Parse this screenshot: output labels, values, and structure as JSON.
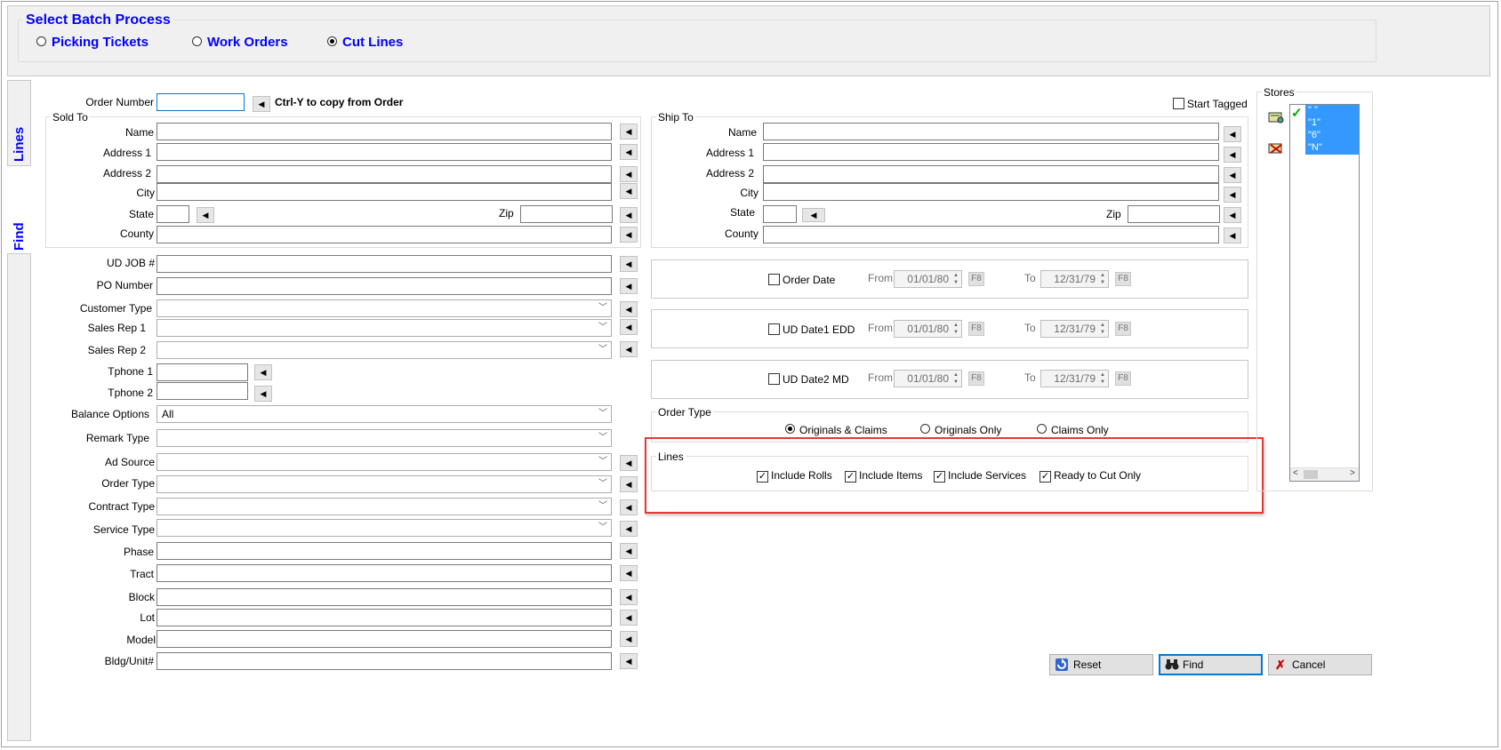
{
  "batch": {
    "title": "Select Batch Process",
    "options": [
      "Picking Tickets",
      "Work Orders",
      "Cut Lines"
    ],
    "selected": "Cut Lines"
  },
  "side_tabs": [
    "Lines",
    "Find"
  ],
  "order_number": {
    "label": "Order Number",
    "value": "",
    "hint": "Ctrl-Y to copy from Order"
  },
  "start_tagged": {
    "label": "Start Tagged",
    "checked": false
  },
  "sold_to": {
    "legend": "Sold To",
    "name": "Name",
    "address1": "Address 1",
    "address2": "Address 2",
    "city": "City",
    "state": "State",
    "zip": "Zip",
    "county": "County"
  },
  "ship_to": {
    "legend": "Ship To",
    "name": "Name",
    "address1": "Address 1",
    "address2": "Address 2",
    "city": "City",
    "state": "State",
    "zip": "Zip",
    "county": "County"
  },
  "fields": {
    "ud_job": "UD JOB #",
    "po_number": "PO Number",
    "customer_type": "Customer Type",
    "sales_rep1": "Sales Rep 1",
    "sales_rep2": "Sales Rep 2",
    "tphone1": "Tphone 1",
    "tphone2": "Tphone 2",
    "balance_options": "Balance Options",
    "balance_value": "All",
    "remark_type": "Remark Type",
    "ad_source": "Ad Source",
    "order_type": "Order Type",
    "contract_type": "Contract Type",
    "service_type": "Service Type",
    "phase": "Phase",
    "tract": "Tract",
    "block": "Block",
    "lot": "Lot",
    "model": "Model",
    "bldg_unit": "Bldg/Unit#"
  },
  "date_filters": [
    {
      "label": "Order Date",
      "from_label": "From",
      "from": "01/01/80",
      "to_label": "To",
      "to": "12/31/79",
      "key": "F8"
    },
    {
      "label": "UD Date1 EDD",
      "from_label": "From",
      "from": "01/01/80",
      "to_label": "To",
      "to": "12/31/79",
      "key": "F8"
    },
    {
      "label": "UD Date2 MD",
      "from_label": "From",
      "from": "01/01/80",
      "to_label": "To",
      "to": "12/31/79",
      "key": "F8"
    }
  ],
  "order_type_group": {
    "legend": "Order Type",
    "options": [
      "Originals & Claims",
      "Originals Only",
      "Claims Only"
    ],
    "selected": "Originals & Claims"
  },
  "lines_group": {
    "legend": "Lines",
    "options": [
      "Include Rolls",
      "Include Items",
      "Include Services",
      "Ready to Cut Only"
    ],
    "checked": [
      true,
      true,
      true,
      true
    ]
  },
  "stores": {
    "legend": "Stores",
    "items": [
      "\" \"",
      "\"1\"",
      "\"6\"",
      "\"N\""
    ]
  },
  "buttons": {
    "reset": "Reset",
    "find": "Find",
    "cancel": "Cancel"
  },
  "colors": {
    "accent_blue": "#0000ff",
    "highlight": "#3399ff",
    "annotation_red": "#e53935"
  }
}
